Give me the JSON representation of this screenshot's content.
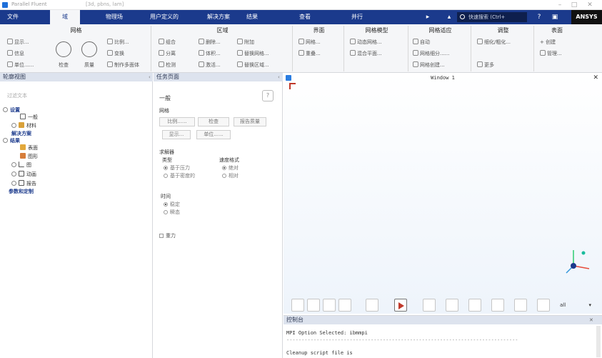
{
  "titlebar": {
    "title": "Parallel Fluent",
    "subtitle": "[3d, pbns, lam]"
  },
  "menu": {
    "tabs": [
      "文件",
      "域",
      "物理场",
      "用户定义的",
      "解决方案",
      "结果",
      "查看",
      "并行"
    ],
    "active_tab": "域",
    "search_placeholder": "快速搜索 (Ctrl+",
    "brand": "ANSYS"
  },
  "ribbon": {
    "groups": [
      {
        "title": "网格",
        "items": [
          "显示...",
          "信息",
          "单位......",
          "检查",
          "质量",
          "比例...",
          "变换",
          "制作多面体"
        ]
      },
      {
        "title": "区域",
        "items": [
          "组合",
          "分离",
          "检测",
          "删除...",
          "体积...",
          "激活...",
          "附加",
          "替换网格...",
          "替换区域..."
        ]
      },
      {
        "title": "界面",
        "items": [
          "网格...",
          "重叠..."
        ]
      },
      {
        "title": "网格模型",
        "items": [
          "动态网格...",
          "混合平面..."
        ]
      },
      {
        "title": "网格适应",
        "items": [
          "自动",
          "网格细分......",
          "网格创建..."
        ]
      },
      {
        "title": "调整",
        "items": [
          "细化/粗化...",
          "更多"
        ]
      },
      {
        "title": "表面",
        "items": [
          "创建",
          "管理..."
        ]
      }
    ]
  },
  "outline": {
    "header": "轮廓视图",
    "filter_placeholder": "过滤文本",
    "items": [
      "设置",
      "一般",
      "材料",
      "解决方案",
      "结果",
      "表面",
      "图形",
      "图",
      "动画",
      "报告",
      "参数和定制"
    ]
  },
  "task_page": {
    "header": "任务页面",
    "section_general": "一般",
    "mesh_label": "网格",
    "mesh_buttons": [
      "比例......",
      "检查",
      "报告质量",
      "显示...",
      "单位......"
    ],
    "solver_label": "求解器",
    "type_label": "类型",
    "type_options": [
      "基于压力",
      "基于密度的"
    ],
    "type_selected": "基于压力",
    "velocity_label": "速度格式",
    "velocity_options": [
      "绝对",
      "相对"
    ],
    "velocity_selected": "绝对",
    "time_label": "时间",
    "time_options": [
      "稳定",
      "瞬态"
    ],
    "time_selected": "稳定",
    "gravity_label": "重力"
  },
  "viewer": {
    "title": "Window 1",
    "view_select": "all"
  },
  "console": {
    "header": "控制台",
    "lines": [
      "MPI Option Selected: ibmmpi",
      "-----------------------------------------------------------------------------",
      "Cleanup script file is"
    ]
  }
}
